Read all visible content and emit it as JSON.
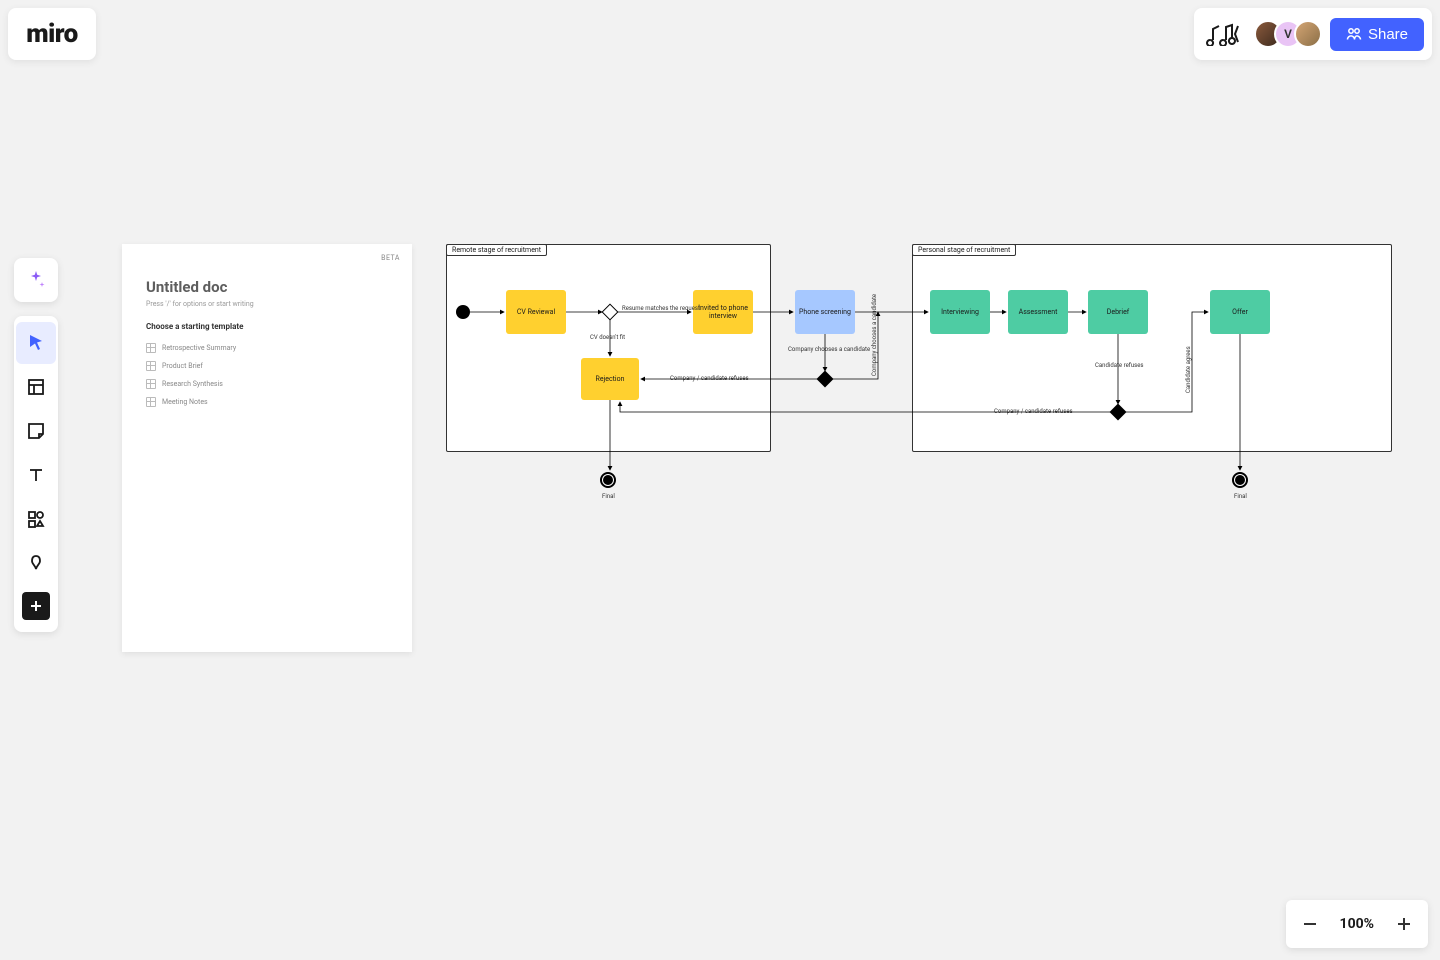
{
  "logo": "miro",
  "header": {
    "share_label": "Share",
    "avatar2_letter": "V"
  },
  "toolbar": {
    "tools": [
      "ai",
      "select",
      "template",
      "sticky",
      "text",
      "shapes",
      "pen",
      "add"
    ]
  },
  "doc": {
    "beta": "BETA",
    "title": "Untitled doc",
    "hint": "Press '/' for options or start writing",
    "section": "Choose a starting template",
    "templates": [
      "Retrospective Summary",
      "Product Brief",
      "Research Synthesis",
      "Meeting Notes"
    ]
  },
  "flow": {
    "panel1_label": "Remote stage of recruitment",
    "panel2_label": "Personal stage of recruitment",
    "nodes": {
      "cv_review": "CV Reviewal",
      "invited": "Invited to phone interview",
      "phone": "Phone screening",
      "rejection": "Rejection",
      "interviewing": "Interviewing",
      "assessment": "Assessment",
      "debrief": "Debrief",
      "offer": "Offer"
    },
    "labels": {
      "resume_matches": "Resume matches the request",
      "cv_no_fit": "CV doesn't fit",
      "company_chooses": "Company chooses a candidate",
      "company_chooses_v": "Company chooses a candidate",
      "company_refuses": "Company / candidate refuses",
      "company_refuses2": "Company / candidate refuses",
      "candidate_refuses": "Candidate refuses",
      "candidate_agrees": "Candidate agrees",
      "final1": "Final",
      "final2": "Final"
    }
  },
  "zoom": {
    "value": "100%"
  }
}
